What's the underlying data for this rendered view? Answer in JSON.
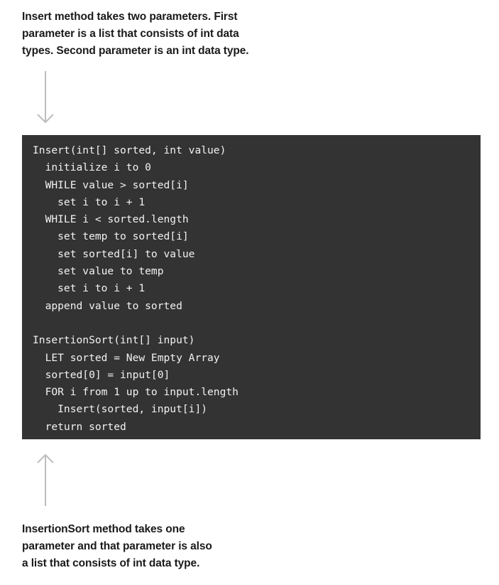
{
  "top_note": {
    "lines": [
      "Insert method takes two parameters. First",
      "parameter is a list that consists of int data",
      "types. Second parameter is an int data type."
    ]
  },
  "bottom_note": {
    "lines": [
      "InsertionSort method takes one",
      "parameter and that parameter is also",
      "a list that consists of int data type."
    ]
  },
  "code": {
    "lines": [
      "Insert(int[] sorted, int value)",
      "  initialize i to 0",
      "  WHILE value > sorted[i]",
      "    set i to i + 1",
      "  WHILE i < sorted.length",
      "    set temp to sorted[i]",
      "    set sorted[i] to value",
      "    set value to temp",
      "    set i to i + 1",
      "  append value to sorted",
      "",
      "InsertionSort(int[] input)",
      "  LET sorted = New Empty Array",
      "  sorted[0] = input[0]",
      "  FOR i from 1 up to input.length",
      "    Insert(sorted, input[i])",
      "  return sorted"
    ]
  },
  "colors": {
    "code_background": "#333333",
    "code_text": "#f2f2f2",
    "note_text": "#1a1a1a",
    "arrow": "#bdbdbd"
  },
  "icons": {
    "top_arrow": "arrow-down-icon",
    "bottom_arrow": "arrow-up-icon"
  }
}
